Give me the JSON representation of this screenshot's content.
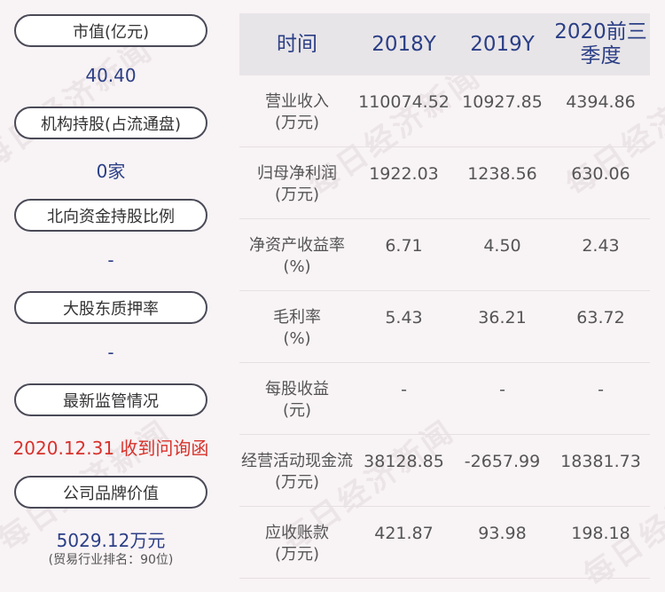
{
  "watermark": "每日经济新闻",
  "left": [
    {
      "label": "市值(亿元)",
      "value": "40.40"
    },
    {
      "label": "机构持股(占流通盘)",
      "value": "0家"
    },
    {
      "label": "北向资金持股比例",
      "value": "-"
    },
    {
      "label": "大股东质押率",
      "value": "-"
    },
    {
      "label": "最新监管情况",
      "value": "2020.12.31 收到问询函"
    },
    {
      "label": "公司品牌价值",
      "value": "5029.12万元",
      "sub": "(贸易行业排名：90位)"
    }
  ],
  "table": {
    "headers": [
      "时间",
      "2018Y",
      "2019Y",
      "2020前三季度"
    ],
    "rows": [
      {
        "label1": "营业收入",
        "label2": "(万元)",
        "v": [
          "110074.52",
          "10927.85",
          "4394.86"
        ]
      },
      {
        "label1": "归母净利润",
        "label2": "(万元)",
        "v": [
          "1922.03",
          "1238.56",
          "630.06"
        ]
      },
      {
        "label1": "净资产收益率",
        "label2": "(%)",
        "v": [
          "6.71",
          "4.50",
          "2.43"
        ]
      },
      {
        "label1": "毛利率",
        "label2": "(%)",
        "v": [
          "5.43",
          "36.21",
          "63.72"
        ]
      },
      {
        "label1": "每股收益",
        "label2": "(元)",
        "v": [
          "-",
          "-",
          "-"
        ]
      },
      {
        "label1": "经营活动现金流",
        "label2": "(万元)",
        "v": [
          "38128.85",
          "-2657.99",
          "18381.73"
        ]
      },
      {
        "label1": "应收账款",
        "label2": "(万元)",
        "v": [
          "421.87",
          "93.98",
          "198.18"
        ]
      }
    ]
  }
}
